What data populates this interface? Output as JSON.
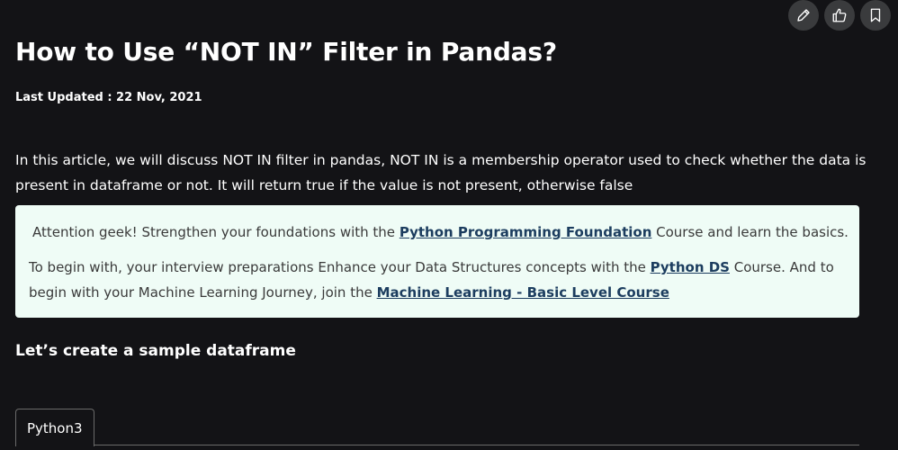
{
  "actions": {
    "edit_icon": "pencil-icon",
    "like_icon": "thumbs-up-icon",
    "bookmark_icon": "bookmark-icon"
  },
  "article": {
    "title": "How to Use “NOT IN” Filter in Pandas?",
    "last_updated": "Last Updated : 22 Nov, 2021",
    "intro": "In this article, we will discuss NOT IN filter in pandas, NOT IN is a membership operator used to check whether the data is present in dataframe or not. It will return true if the value is not  present, otherwise false"
  },
  "note": {
    "line1_before": "Attention geek! Strengthen your foundations with the ",
    "line1_link": "Python Programming Foundation",
    "line1_after": " Course and learn the basics.",
    "line2_before": "To begin with, your interview preparations Enhance your Data Structures concepts with the ",
    "line2_link1": "Python DS",
    "line2_middle": " Course. And to begin with your Machine Learning Journey, join the ",
    "line2_link2": "Machine Learning - Basic Level Course"
  },
  "section": {
    "heading": "Let’s create a sample dataframe"
  },
  "code": {
    "tab_label": "Python3"
  },
  "colors": {
    "background": "#131316",
    "note_background": "#effcf6",
    "link": "#1c3d5f",
    "icon_button": "#3a3b3d"
  }
}
